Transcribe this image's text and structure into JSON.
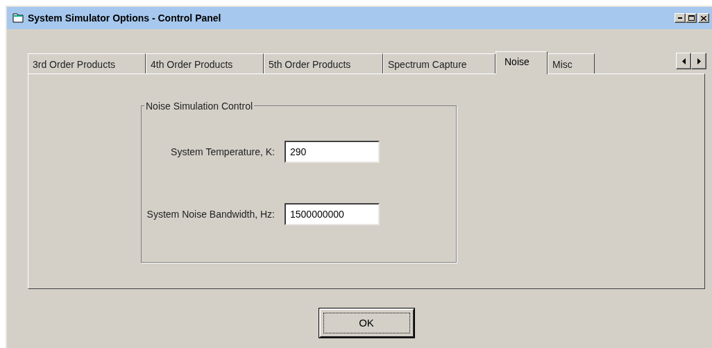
{
  "window": {
    "title": "System Simulator Options - Control Panel"
  },
  "tabs": [
    {
      "label": "3rd Order Products",
      "selected": false
    },
    {
      "label": "4th Order Products",
      "selected": false
    },
    {
      "label": "5th Order Products",
      "selected": false
    },
    {
      "label": "Spectrum Capture",
      "selected": false
    },
    {
      "label": "Noise",
      "selected": true
    },
    {
      "label": "Misc",
      "selected": false
    }
  ],
  "group": {
    "title": "Noise Simulation Control",
    "fields": [
      {
        "label": "System Temperature, K:",
        "value": "290"
      },
      {
        "label": "System Noise Bandwidth, Hz:",
        "value": "1500000000"
      }
    ]
  },
  "buttons": [
    "OK"
  ]
}
